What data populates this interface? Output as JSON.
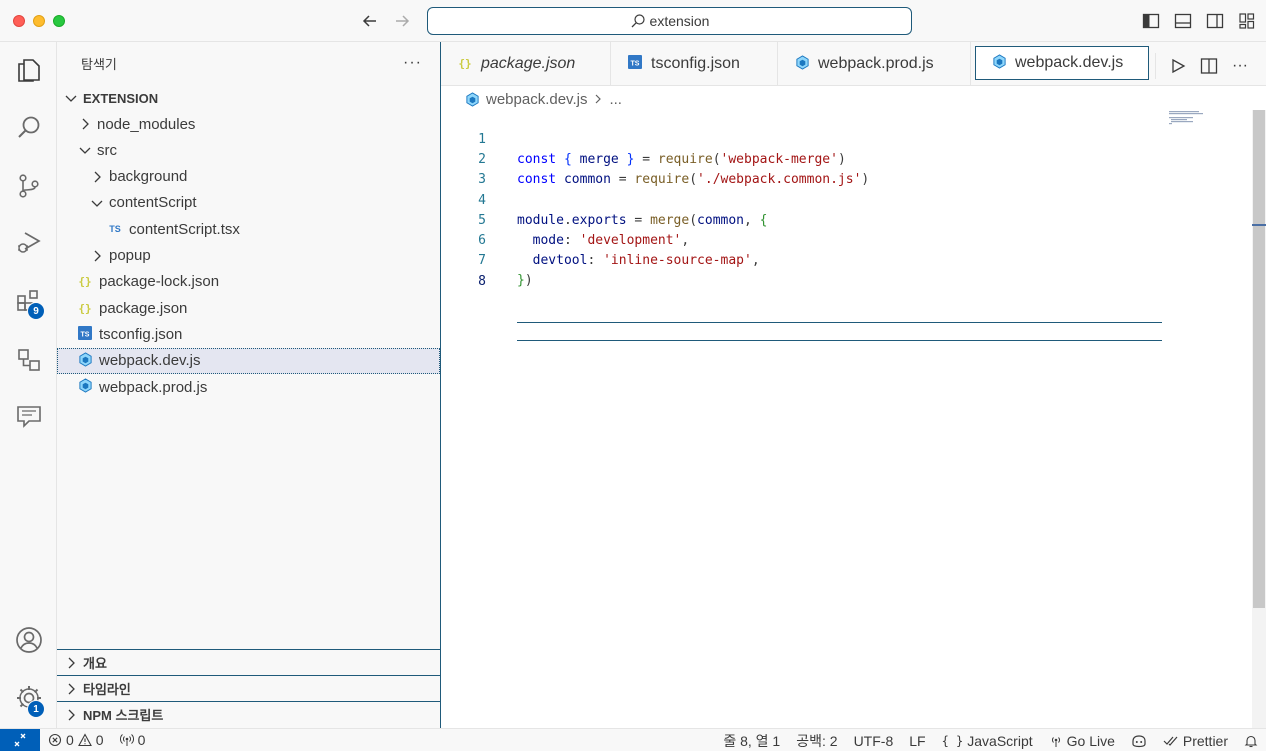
{
  "titlebar": {
    "search_text": "extension"
  },
  "activity_bar": {
    "extensions_badge": "9",
    "settings_badge": "1"
  },
  "sidebar": {
    "title": "탐색기",
    "more": "···",
    "root": "EXTENSION",
    "items": [
      {
        "label": "node_modules",
        "type": "folder",
        "expanded": false,
        "depth": 1
      },
      {
        "label": "src",
        "type": "folder",
        "expanded": true,
        "depth": 1
      },
      {
        "label": "background",
        "type": "folder",
        "expanded": false,
        "depth": 2
      },
      {
        "label": "contentScript",
        "type": "folder",
        "expanded": true,
        "depth": 2
      },
      {
        "label": "contentScript.tsx",
        "type": "ts",
        "depth": 3
      },
      {
        "label": "popup",
        "type": "folder",
        "expanded": false,
        "depth": 2
      },
      {
        "label": "package-lock.json",
        "type": "json",
        "depth": 1
      },
      {
        "label": "package.json",
        "type": "json",
        "depth": 1
      },
      {
        "label": "tsconfig.json",
        "type": "tsconfig",
        "depth": 1
      },
      {
        "label": "webpack.dev.js",
        "type": "webpack",
        "depth": 1,
        "selected": true
      },
      {
        "label": "webpack.prod.js",
        "type": "webpack",
        "depth": 1
      }
    ],
    "sections": [
      "개요",
      "타임라인",
      "NPM 스크립트"
    ]
  },
  "editor": {
    "tabs": [
      {
        "label": "package.json",
        "icon": "json",
        "italic": true
      },
      {
        "label": "tsconfig.json",
        "icon": "tsconfig"
      },
      {
        "label": "webpack.prod.js",
        "icon": "webpack"
      },
      {
        "label": "webpack.dev.js",
        "icon": "webpack",
        "active": true
      }
    ],
    "breadcrumb_file": "webpack.dev.js",
    "breadcrumb_more": "...",
    "code_lines": [
      {
        "n": "1",
        "text": "const { merge } = require('webpack-merge')"
      },
      {
        "n": "2",
        "text": "const common = require('./webpack.common.js')"
      },
      {
        "n": "3",
        "text": ""
      },
      {
        "n": "4",
        "text": "module.exports = merge(common, {"
      },
      {
        "n": "5",
        "text": "  mode: 'development',"
      },
      {
        "n": "6",
        "text": "  devtool: 'inline-source-map',"
      },
      {
        "n": "7",
        "text": "})"
      },
      {
        "n": "8",
        "text": ""
      }
    ],
    "active_line": "8"
  },
  "statusbar": {
    "errors": "0",
    "warnings": "0",
    "ports": "0",
    "position": "줄 8, 열 1",
    "spaces": "공백: 2",
    "encoding": "UTF-8",
    "eol": "LF",
    "language": "JavaScript",
    "golive": "Go Live",
    "prettier": "Prettier"
  },
  "colors": {
    "accent": "#005fb8",
    "focus_border": "#1f5a7a"
  }
}
